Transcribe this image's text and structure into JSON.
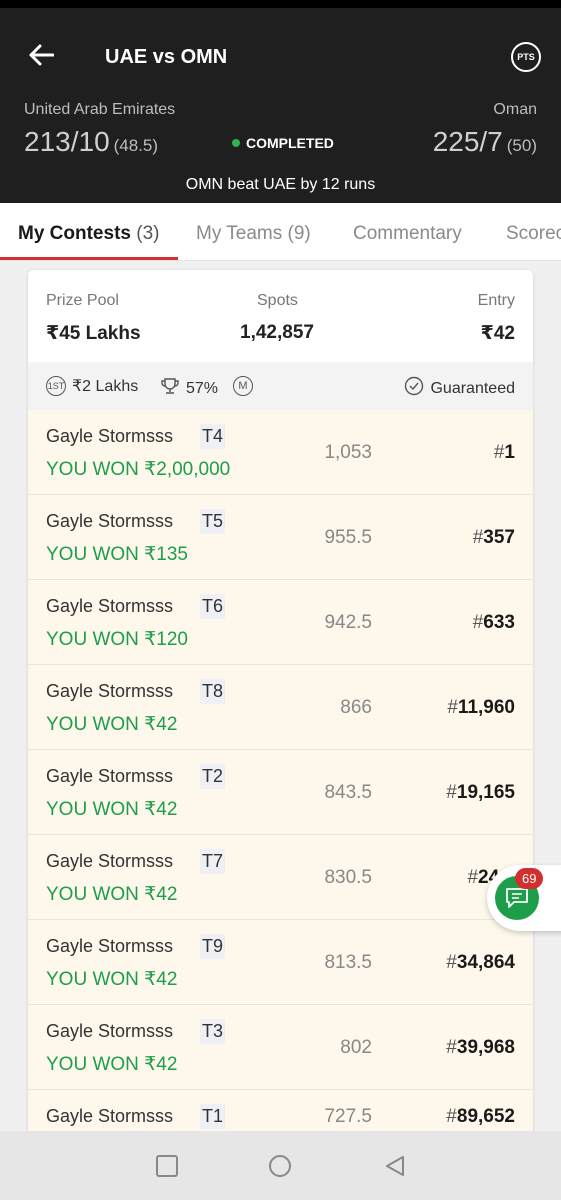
{
  "header": {
    "title": "UAE vs OMN",
    "pts_label": "PTS",
    "team_left": {
      "name": "United Arab Emirates",
      "score": "213/10",
      "overs": "(48.5)"
    },
    "team_right": {
      "name": "Oman",
      "score": "225/7",
      "overs": "(50)"
    },
    "status": "COMPLETED",
    "result": "OMN beat UAE by 12 runs",
    "status_color": "#2fb34a"
  },
  "tabs": [
    {
      "label": "My Contests",
      "count": "(3)"
    },
    {
      "label": "My Teams",
      "count": "(9)"
    },
    {
      "label": "Commentary"
    },
    {
      "label": "Scorecard"
    }
  ],
  "contest": {
    "prize_pool_label": "Prize Pool",
    "prize_pool": "₹45 Lakhs",
    "spots_label": "Spots",
    "spots": "1,42,857",
    "entry_label": "Entry",
    "entry": "₹42",
    "first_prize": "₹2 Lakhs",
    "first_prize_icon_text": "1ST",
    "win_pct": "57%",
    "multi_icon_text": "M",
    "guaranteed": "Guaranteed"
  },
  "entries": [
    {
      "name": "Gayle Stormsss",
      "team": "T4",
      "won": "YOU WON ₹2,00,000",
      "points": "1,053",
      "rank": "1"
    },
    {
      "name": "Gayle Stormsss",
      "team": "T5",
      "won": "YOU WON ₹135",
      "points": "955.5",
      "rank": "357"
    },
    {
      "name": "Gayle Stormsss",
      "team": "T6",
      "won": "YOU WON ₹120",
      "points": "942.5",
      "rank": "633"
    },
    {
      "name": "Gayle Stormsss",
      "team": "T8",
      "won": "YOU WON ₹42",
      "points": "866",
      "rank": "11,960"
    },
    {
      "name": "Gayle Stormsss",
      "team": "T2",
      "won": "YOU WON ₹42",
      "points": "843.5",
      "rank": "19,165"
    },
    {
      "name": "Gayle Stormsss",
      "team": "T7",
      "won": "YOU WON ₹42",
      "points": "830.5",
      "rank": "24,3"
    },
    {
      "name": "Gayle Stormsss",
      "team": "T9",
      "won": "YOU WON ₹42",
      "points": "813.5",
      "rank": "34,864"
    },
    {
      "name": "Gayle Stormsss",
      "team": "T3",
      "won": "YOU WON ₹42",
      "points": "802",
      "rank": "39,968"
    },
    {
      "name": "Gayle Stormsss",
      "team": "T1",
      "won": "",
      "points": "727.5",
      "rank": "89,652"
    }
  ],
  "chat": {
    "badge": "69"
  },
  "colors": {
    "header_bg": "#1f1f1f",
    "accent_red": "#d32f2f",
    "win_green": "#1e9e4a",
    "row_bg": "#fdf8eb"
  }
}
